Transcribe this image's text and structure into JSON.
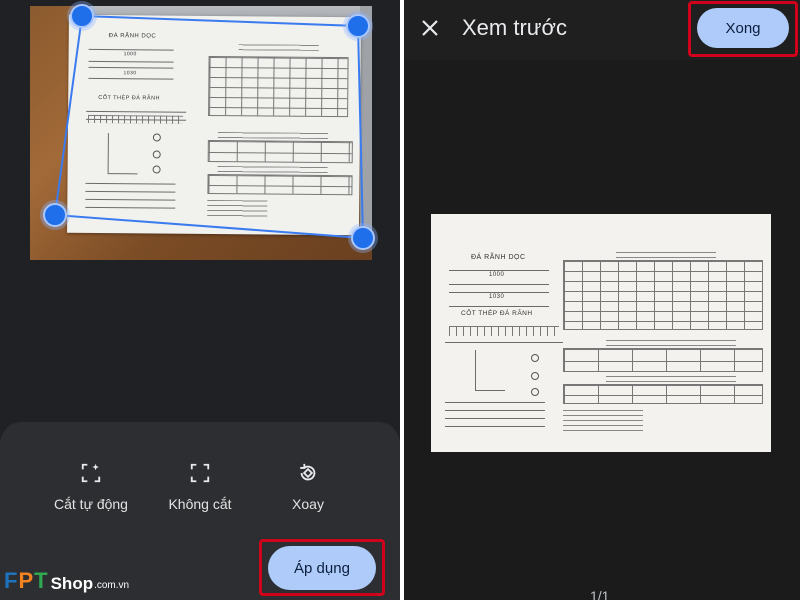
{
  "crop_screen": {
    "tools": [
      {
        "label": "Cắt tự động",
        "icon": "auto-crop-icon"
      },
      {
        "label": "Không cắt",
        "icon": "no-crop-icon"
      },
      {
        "label": "Xoay",
        "icon": "rotate-icon"
      }
    ],
    "apply_label": "Áp dụng",
    "document": {
      "title": "ĐÁ RÃNH DỌC",
      "section": "CỐT THÉP ĐÁ RÃNH",
      "dimension_top": "1000",
      "dimension_bottom": "1030"
    }
  },
  "preview_screen": {
    "title": "Xem trước",
    "done_label": "Xong",
    "page_indicator": "1/1"
  },
  "watermark": {
    "brand_f": "F",
    "brand_p": "P",
    "brand_t": "T",
    "shop": "Shop",
    "domain": ".com.vn"
  },
  "colors": {
    "accent_button": "#aecbfa",
    "highlight_box": "#d0021b",
    "crop_handle": "#1f6feb",
    "background": "#202124"
  }
}
